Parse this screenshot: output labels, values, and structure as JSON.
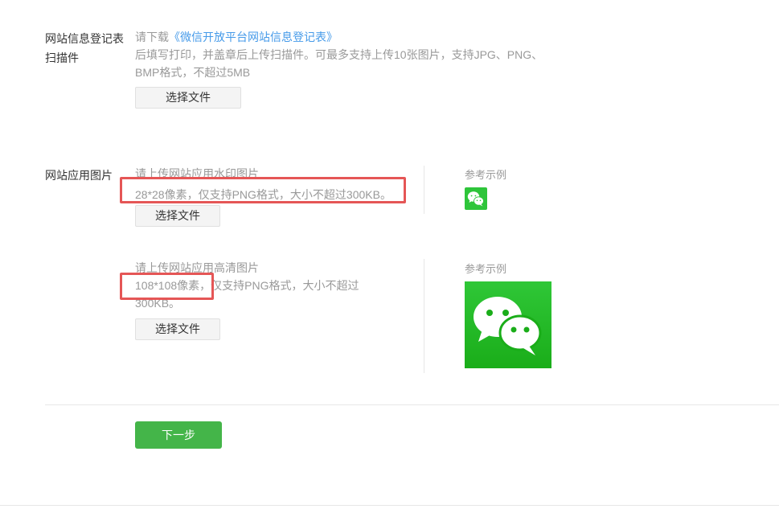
{
  "sec1": {
    "label_line1": "网站信息登记表",
    "label_line2": "扫描件",
    "hint_prefix": "请下载",
    "hint_link": "《微信开放平台网站信息登记表》",
    "hint_line2": "后填写打印，并盖章后上传扫描件。可最多支持上传10张图片，支持JPG、PNG、",
    "hint_line3": "BMP格式，不超过5MB",
    "button": "选择文件"
  },
  "sec2": {
    "label": "网站应用图片",
    "row1": {
      "hint_line1": "请上传网站应用水印图片",
      "hint_line2": "28*28像素，仅支持PNG格式，大小不超过300KB。",
      "button": "选择文件",
      "ref_label": "参考示例",
      "ref_icon": "wechat-logo-icon"
    },
    "row2": {
      "hint_line1": "请上传网站应用高清图片",
      "hint_line2": "108*108像素，仅支持PNG格式，大小不超过",
      "hint_line3": "300KB。",
      "button": "选择文件",
      "ref_label": "参考示例",
      "ref_icon": "wechat-logo-icon"
    }
  },
  "footer": {
    "next_button": "下一步"
  },
  "colors": {
    "accent_green": "#44b549",
    "link_blue": "#459ae9",
    "highlight_red": "#e55656",
    "wechat_green": "#1aad19"
  }
}
